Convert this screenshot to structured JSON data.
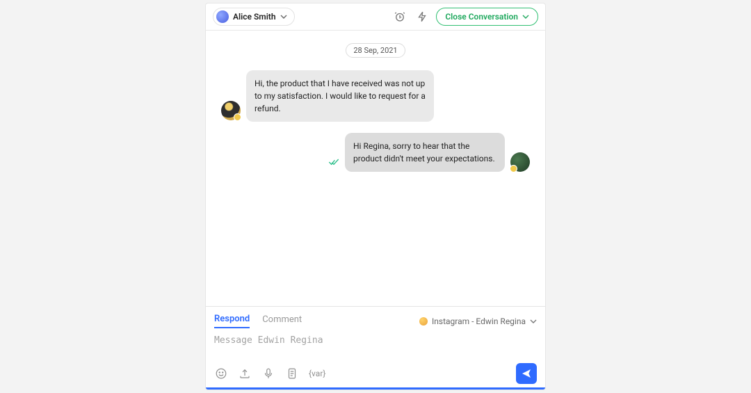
{
  "header": {
    "assignee_name": "Alice Smith",
    "close_label": "Close Conversation"
  },
  "conversation": {
    "date": "28 Sep, 2021",
    "messages": [
      {
        "side": "left",
        "text": "Hi, the product that I have received was not up to my satisfaction. I would like to request for a refund."
      },
      {
        "side": "right",
        "text": "Hi Regina, sorry to hear that the product didn't meet your expectations."
      }
    ]
  },
  "composer": {
    "tabs": {
      "respond": "Respond",
      "comment": "Comment"
    },
    "channel_label": "Instagram - Edwin Regina",
    "placeholder": "Message Edwin Regina",
    "var_label": "{var}"
  }
}
